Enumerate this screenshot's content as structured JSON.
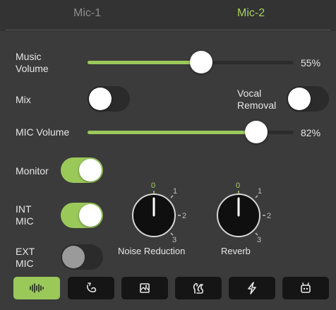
{
  "tabs": [
    {
      "label": "Mic-1",
      "active": false
    },
    {
      "label": "Mic-2",
      "active": true
    }
  ],
  "music_volume": {
    "label": "Music\nVolume",
    "value_text": "55%",
    "value": 0.55
  },
  "mix": {
    "label": "Mix",
    "on": false
  },
  "vocal_removal": {
    "label": "Vocal\nRemoval",
    "on": false
  },
  "mic_volume": {
    "label": "MIC Volume",
    "value_text": "82%",
    "value": 0.82
  },
  "monitor": {
    "label": "Monitor",
    "on": true
  },
  "int_mic": {
    "label": "INT\nMIC",
    "on": true
  },
  "ext_mic": {
    "label": "EXT\nMIC",
    "on": false,
    "disabled": true
  },
  "noise_reduction": {
    "label": "Noise Reduction",
    "value": 0,
    "ticks": [
      "0",
      "1",
      "2",
      "3"
    ]
  },
  "reverb": {
    "label": "Reverb",
    "value": 0,
    "ticks": [
      "0",
      "1",
      "2",
      "3"
    ]
  },
  "mode_buttons": [
    {
      "icon": "waveform-icon",
      "active": true
    },
    {
      "icon": "moon-icon",
      "active": false
    },
    {
      "icon": "picture-icon",
      "active": false
    },
    {
      "icon": "squirrel-icon",
      "active": false
    },
    {
      "icon": "lightning-icon",
      "active": false
    },
    {
      "icon": "robot-icon",
      "active": false
    }
  ],
  "colors": {
    "accent": "#9ac95a",
    "tick_zero": "#a6d25b",
    "background": "#3b3b3b"
  }
}
